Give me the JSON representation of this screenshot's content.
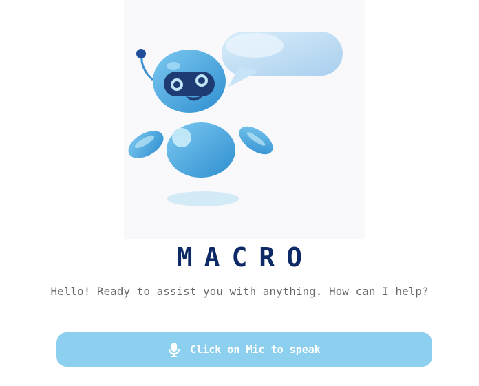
{
  "app": {
    "name": "MACRO",
    "greeting": "Hello! Ready to assist you with anything. How can I help?"
  },
  "speak_button": {
    "label": "Click on Mic to speak",
    "icon": "microphone-icon"
  },
  "illustration": {
    "subject": "robot-assistant-illustration",
    "colors": {
      "robot_body": "#4aa8e0",
      "robot_light": "#bfe7f7",
      "visor": "#1f3b73",
      "bubble": "#c7e3f7",
      "shadow": "#d3ebf7"
    }
  },
  "colors": {
    "title": "#0d2a66",
    "subtitle": "#666666",
    "button_bg": "#8ccfee",
    "button_text": "#ffffff"
  }
}
